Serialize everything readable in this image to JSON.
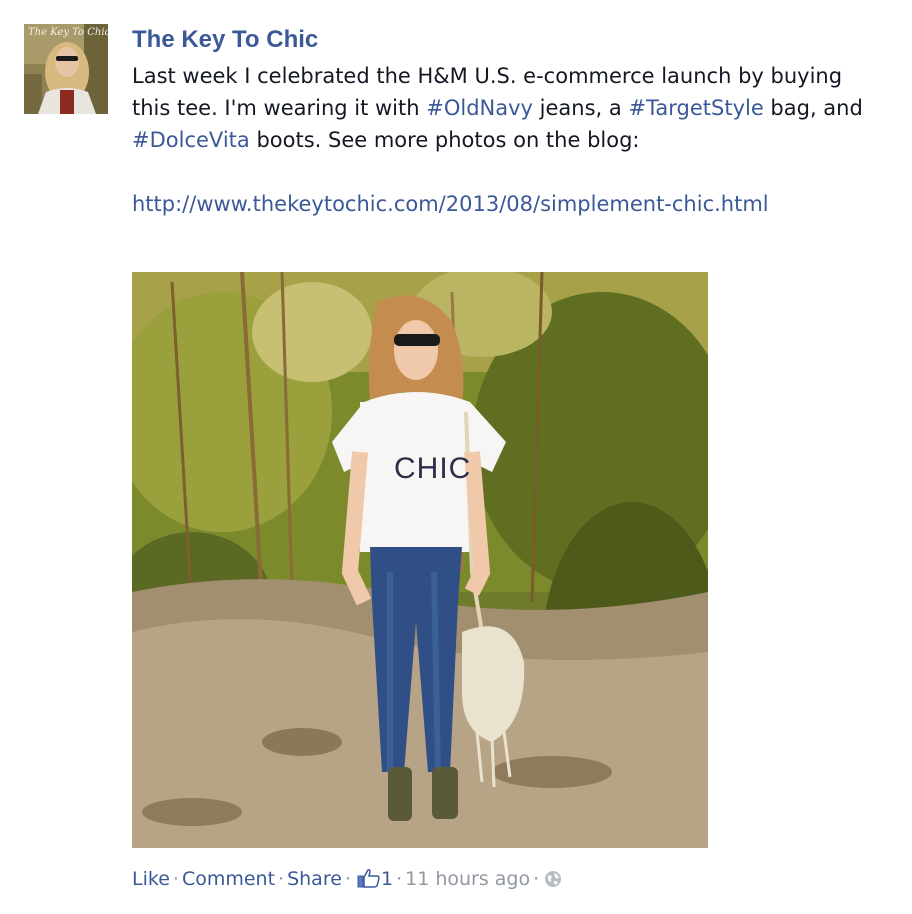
{
  "post": {
    "author": "The Key To Chic",
    "avatar_caption": "The Key To Chic",
    "message": {
      "part1": "Last week I celebrated the H&M U.S. e-commerce launch by buying this tee. I'm wearing it with ",
      "hashtag1": "#OldNavy",
      "part2": " jeans, a ",
      "hashtag2": "#TargetStyle",
      "part3": " bag, and ",
      "hashtag3": "#DolceVita",
      "part4": " boots. See more photos on the blog:"
    },
    "url": "http://www.thekeytochic.com/2013/08/simplement-chic.html",
    "photo": {
      "shirt_text": "CHIC"
    },
    "actions": {
      "like": "Like",
      "comment": "Comment",
      "share": "Share",
      "separator": "·",
      "like_count": "1",
      "timestamp": "11 hours ago"
    },
    "icons": {
      "like": "thumbs-up-icon",
      "privacy": "globe-icon"
    }
  },
  "colors": {
    "link": "#3b5998",
    "text": "#141823",
    "meta": "#9197a3"
  }
}
